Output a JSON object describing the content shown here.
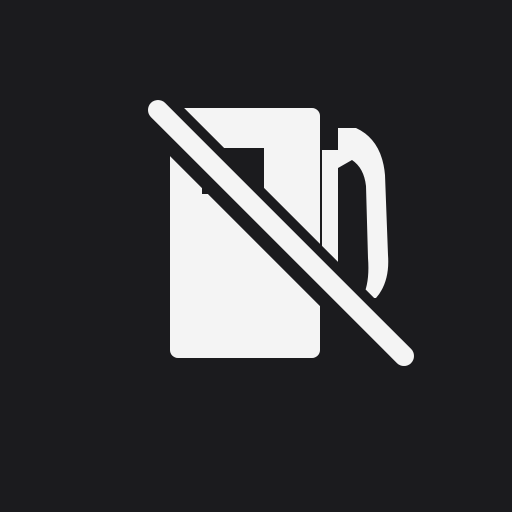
{
  "button": {
    "icon": "no-fuel-icon",
    "background_color": "#1b1b1e",
    "icon_color": "#f4f4f4"
  }
}
